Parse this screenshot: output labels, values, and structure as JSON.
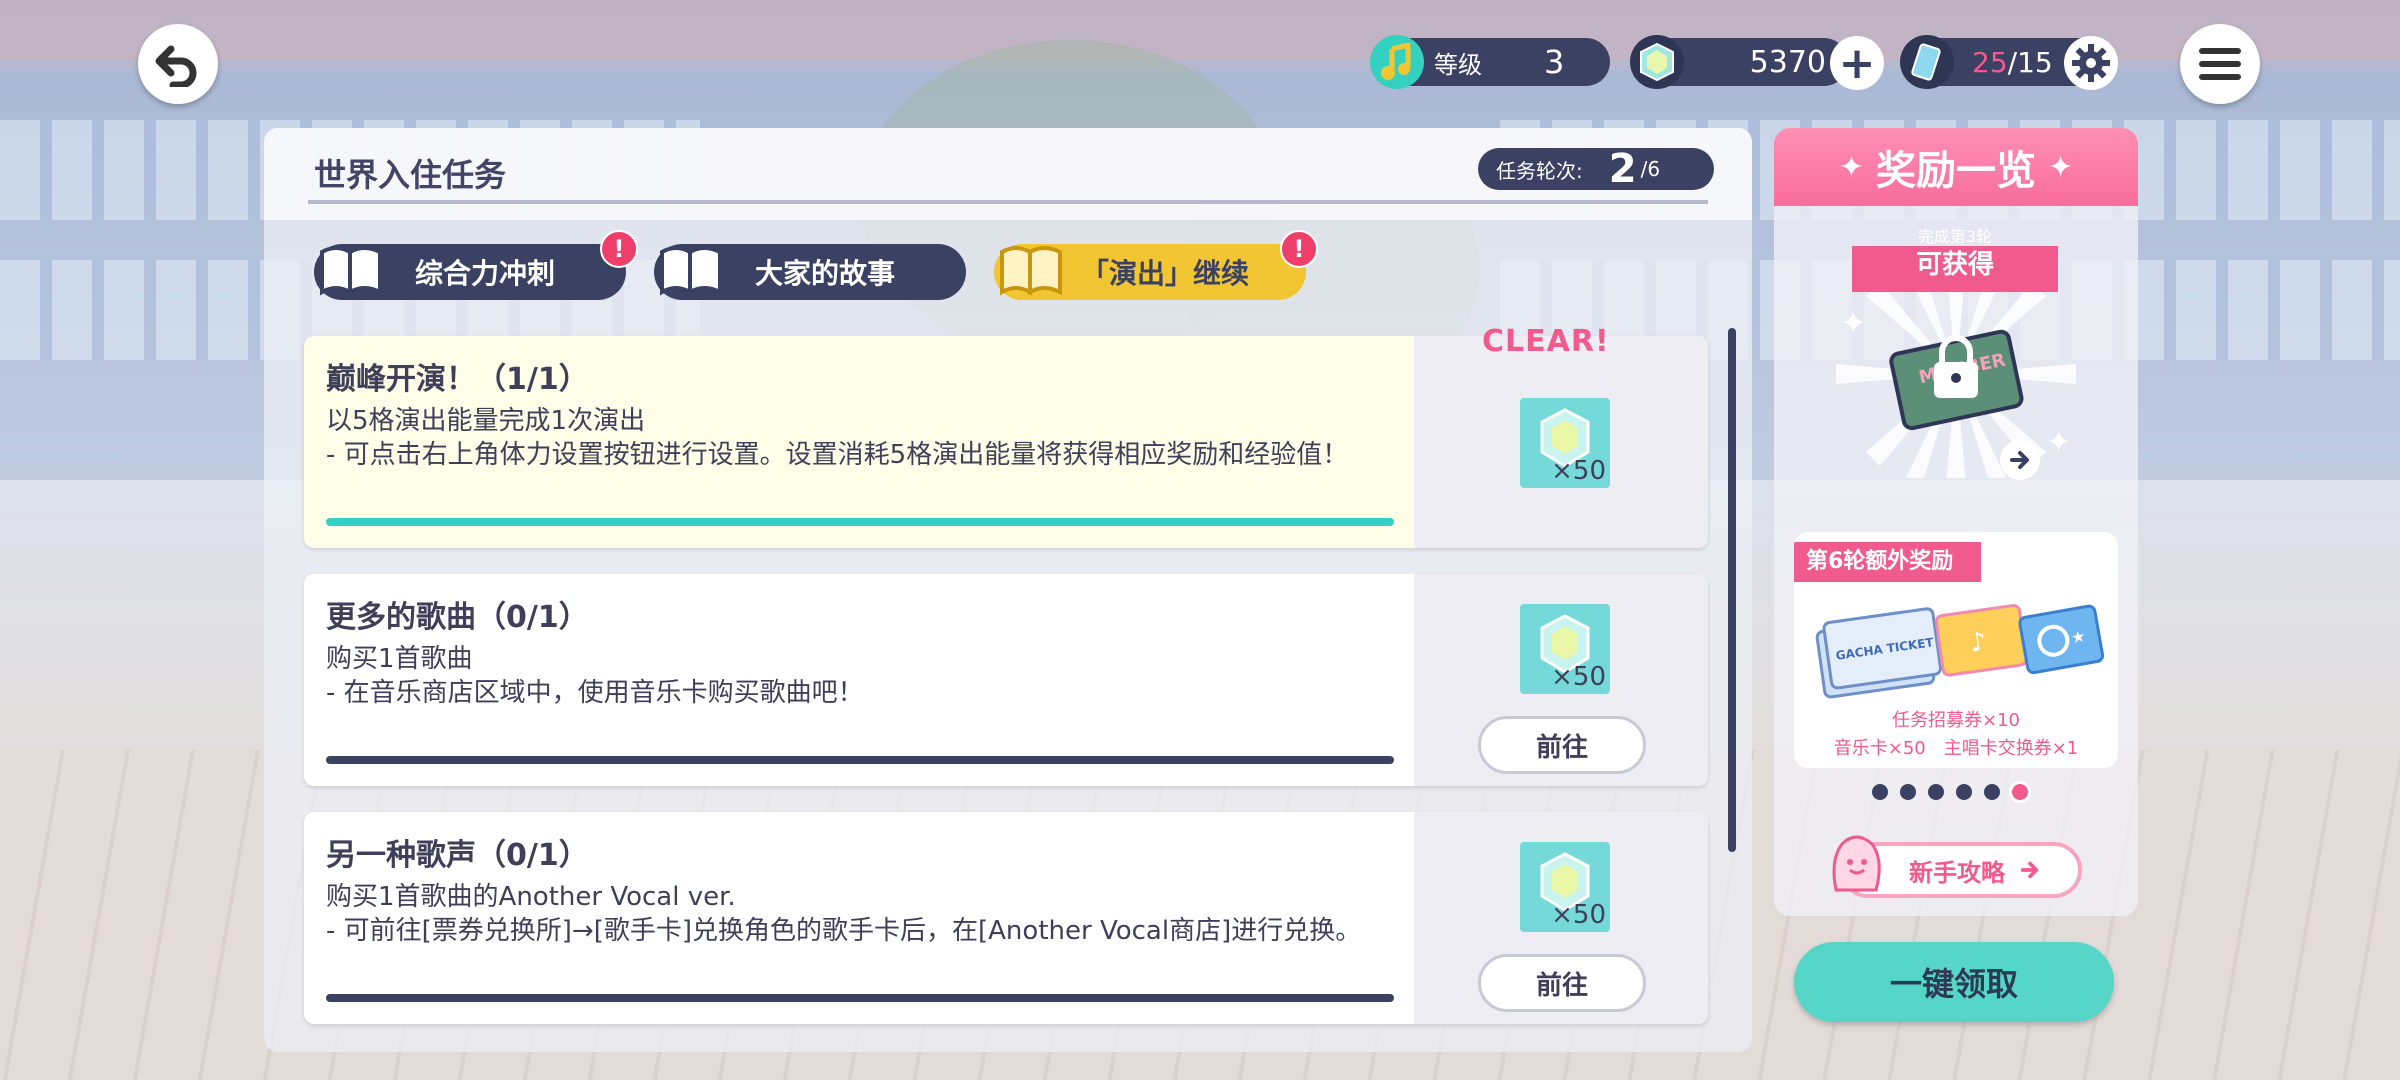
{
  "header": {
    "level_label": "等级",
    "level_value": "3",
    "gems": "5370",
    "energy_current": "25",
    "energy_max": "/15"
  },
  "panel": {
    "title": "世界入住任务",
    "round_label": "任务轮次:",
    "round_current": "2",
    "round_total": "/6"
  },
  "tabs": [
    {
      "label": "综合力冲刺",
      "badge": "!"
    },
    {
      "label": "大家的故事",
      "badge": ""
    },
    {
      "label": "「演出」继续",
      "badge": "!"
    }
  ],
  "missions": [
    {
      "title": "巅峰开演！（1/1）",
      "desc": "以5格演出能量完成1次演出\n- 可点击右上角体力设置按钮进行设置。设置消耗5格演出能量将获得相应奖励和经验值！",
      "reward_qty": "×50",
      "status": "CLEAR!",
      "progress": 1.0
    },
    {
      "title": "更多的歌曲（0/1）",
      "desc": "购买1首歌曲\n- 在音乐商店区域中，使用音乐卡购买歌曲吧！",
      "reward_qty": "×50",
      "button": "前往",
      "progress": 0.0
    },
    {
      "title": "另一种歌声（0/1）",
      "desc": "购买1首歌曲的Another Vocal ver.\n- 可前往[票券兑换所]→[歌手卡]兑换角色的歌手卡后，在[Another Vocal商店]进行兑换。",
      "reward_qty": "×50",
      "button": "前往",
      "progress": 0.0
    }
  ],
  "rewards_panel": {
    "title": "奖励一览",
    "ribbon_line1": "完成第3轮",
    "ribbon_line2": "可获得",
    "bonus_tag": "第6轮额外奖励",
    "bonus_line1": "任务招募券×10",
    "bonus_line2": "音乐卡×50　主唱卡交换券×1",
    "ticket_text": "GACHA TICKET",
    "member_text": "MEMBER",
    "guide_label": "新手攻略",
    "dots_total": 6,
    "dots_active": 6
  },
  "claim_all": "一键领取",
  "colors": {
    "navy": "#3b4163",
    "pink": "#f05a8c",
    "teal": "#56d6c8",
    "yellow": "#f2c632"
  }
}
